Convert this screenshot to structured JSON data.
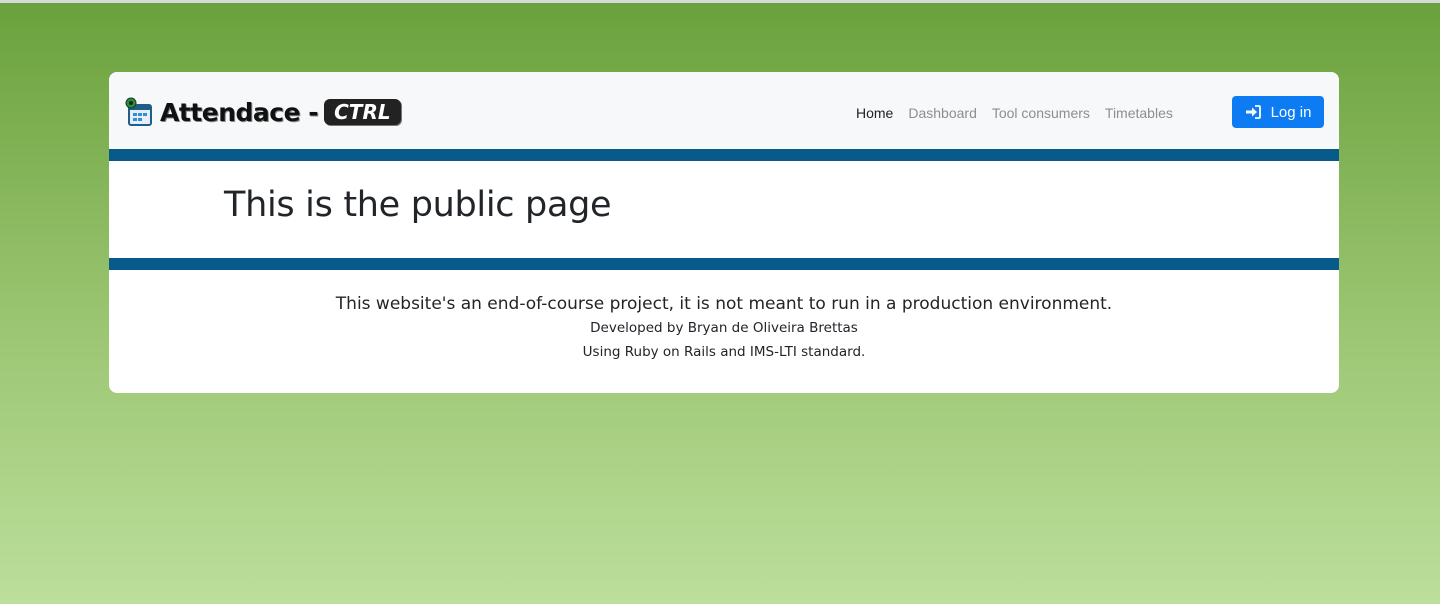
{
  "brand": {
    "name": "Attendace -",
    "badge": "CTRL"
  },
  "nav": {
    "items": [
      {
        "label": "Home",
        "active": true
      },
      {
        "label": "Dashboard",
        "active": false
      },
      {
        "label": "Tool consumers",
        "active": false
      },
      {
        "label": "Timetables",
        "active": false
      }
    ],
    "login_label": "Log in",
    "login_icon": "sign-in-icon"
  },
  "hero": {
    "title": "This is the public page"
  },
  "footer": {
    "notice": "This website's an end-of-course project, it is not meant to run in a production environment.",
    "author": "Developed by Bryan de Oliveira Brettas",
    "tech": "Using Ruby on Rails and IMS-LTI standard."
  },
  "colors": {
    "band": "#075a8a",
    "login_button": "#0d7cf2",
    "background_top": "#6aa13c",
    "background_bottom": "#bcdf9c"
  }
}
